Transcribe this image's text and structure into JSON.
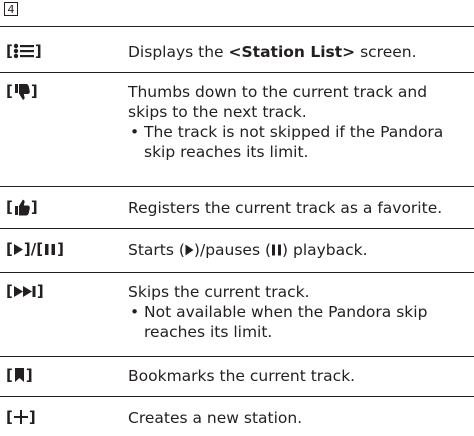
{
  "step_number": "4",
  "rows": [
    {
      "icon": "station-list-icon",
      "description": [
        "Displays the ",
        "<Station List>",
        " screen."
      ]
    },
    {
      "icon": "thumbs-down-icon",
      "description": "Thumbs down to the current track and skips to the next track.",
      "note": "The track is not skipped if the Pandora skip reaches its limit."
    },
    {
      "icon": "thumbs-up-icon",
      "description": "Registers the current track as a favorite."
    },
    {
      "icon": "play-pause-icon",
      "description": [
        "Starts (",
        ")/pauses (",
        ") playback."
      ]
    },
    {
      "icon": "skip-icon",
      "description": "Skips the current track.",
      "note": "Not available when the Pandora skip reaches its limit."
    },
    {
      "icon": "bookmark-icon",
      "description": "Bookmarks the current track."
    },
    {
      "icon": "new-station-icon",
      "description": "Creates a new station."
    }
  ],
  "bullet_char": "•"
}
